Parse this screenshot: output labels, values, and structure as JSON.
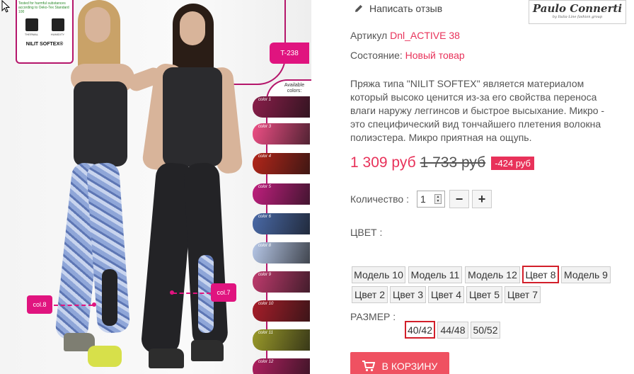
{
  "review": {
    "label": "Написать отзыв",
    "icon": "pencil-icon"
  },
  "brand": {
    "name": "Paulo Connerti",
    "tagline": "by Italia-Line fashion group"
  },
  "product": {
    "article_label": "Артикул",
    "article_value": "Dnl_ACTIVE 38",
    "condition_label": "Состояние:",
    "condition_value": "Новый товар",
    "description": "Пряжа типа \"NILIT SOFTEX\" является материалом который высоко ценится из-за его свойства переноса влаги наружу леггинсов и быстрое высыхание. Микро - это специфический вид тончайшего плетения волокна полиэстера. Микро приятная на ощупь."
  },
  "price": {
    "current": "1 309 руб",
    "old": "1 733 руб",
    "discount": "-424 руб"
  },
  "quantity": {
    "label": "Количество :",
    "value": "1",
    "minus": "−",
    "plus": "+"
  },
  "color_section": {
    "label": "ЦВЕТ :",
    "options": [
      "Модель 10",
      "Модель 11",
      "Модель 12",
      "Цвет 8",
      "Модель 9",
      "Цвет 2",
      "Цвет 3",
      "Цвет 4",
      "Цвет 5",
      "Цвет 7"
    ],
    "selected": "Цвет 8"
  },
  "size_section": {
    "label": "РАЗМЕР :",
    "options": [
      "40/42",
      "44/48",
      "50/52"
    ],
    "selected": "40/42"
  },
  "cart": {
    "label": "В КОРЗИНУ",
    "icon": "cart-icon"
  },
  "image": {
    "tcode": "T-238",
    "available_caption": "Available colors:",
    "tag_left": "col.8",
    "tag_right": "col.7",
    "nilit": "NILIT SOFTEX®",
    "label_text": "Tested for harmful substances according to Oeko-Tex Standard 100",
    "icon_captions": [
      "THERMAL",
      "HUMIDITY"
    ],
    "swatches": [
      {
        "label": "color 1",
        "color": "#8a1e4a"
      },
      {
        "label": "color 3",
        "color": "#ef4f86"
      },
      {
        "label": "color 4",
        "color": "#b3261a"
      },
      {
        "label": "color 5",
        "color": "#c01f7e"
      },
      {
        "label": "color 6",
        "color": "#4a6aa8"
      },
      {
        "label": "color 8",
        "color": "#b7c8e8"
      },
      {
        "label": "color 9",
        "color": "#c03b6e"
      },
      {
        "label": "color 10",
        "color": "#a81e2a"
      },
      {
        "label": "color 11",
        "color": "#9a9a2a"
      },
      {
        "label": "color 12",
        "color": "#b02060"
      }
    ]
  }
}
